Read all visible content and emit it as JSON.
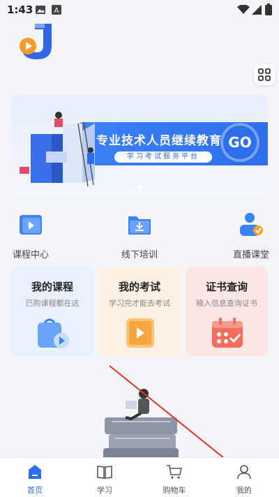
{
  "status_bar": {
    "time": "1:43"
  },
  "banner": {
    "title": "专业技术人员继续教育",
    "subtitle": "学习考试服务平台",
    "go_label": "GO"
  },
  "quick_entries": [
    {
      "label": "课程中心",
      "icon": "play-folder-icon"
    },
    {
      "label": "线下培训",
      "icon": "download-folder-icon"
    },
    {
      "label": "直播课堂",
      "icon": "live-person-icon"
    }
  ],
  "cards": [
    {
      "title": "我的课程",
      "subtitle": "已购课程都在这",
      "icon": "shopping-bag-play-icon",
      "bg": "#e8f1fd"
    },
    {
      "title": "我的考试",
      "subtitle": "学习完才能去考试",
      "icon": "exam-play-icon",
      "bg": "#fdf1e3"
    },
    {
      "title": "证书查询",
      "subtitle": "输入信息查询证书",
      "icon": "calendar-check-icon",
      "bg": "#fde7e5"
    }
  ],
  "tabbar": {
    "items": [
      {
        "label": "首页",
        "icon": "home-icon",
        "active": true
      },
      {
        "label": "学习",
        "icon": "book-icon",
        "active": false
      },
      {
        "label": "购物车",
        "icon": "cart-icon",
        "active": false
      },
      {
        "label": "我的",
        "icon": "user-icon",
        "active": false
      }
    ]
  },
  "colors": {
    "accent": "#2f6eea",
    "annotation": "#d9332b"
  }
}
